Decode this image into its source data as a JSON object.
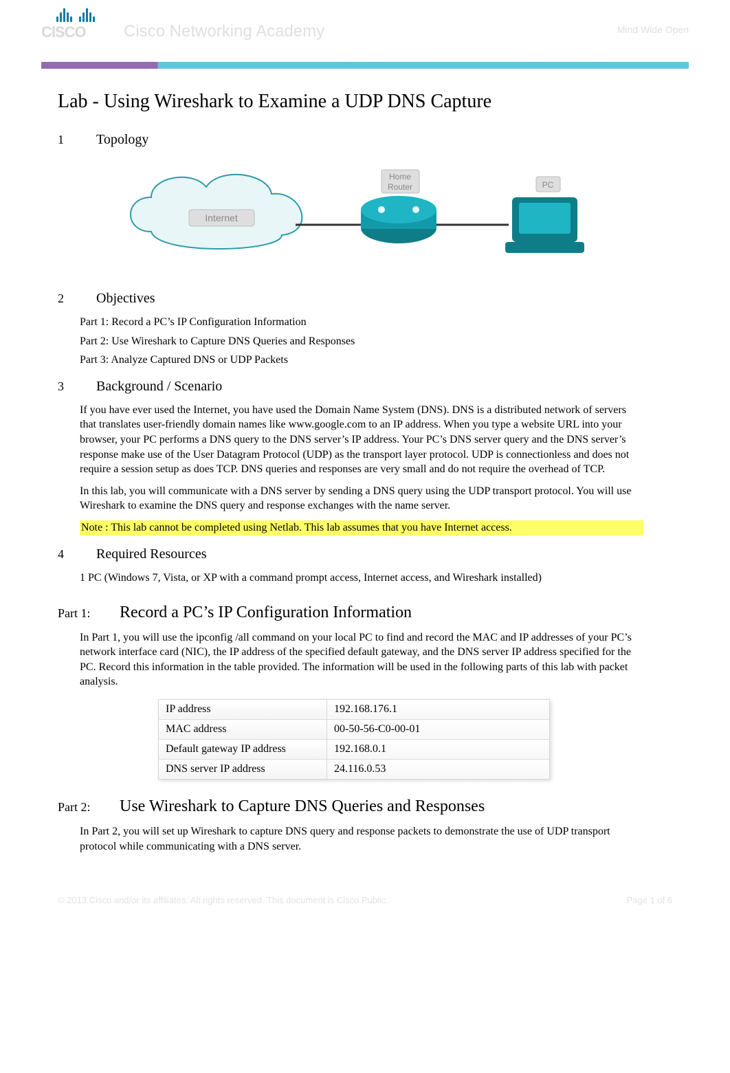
{
  "header": {
    "logo_text": "CISCO",
    "academy": "Cisco Networking Academy",
    "right_label": "Mind Wide Open"
  },
  "doc_title": "Lab - Using Wireshark to Examine a UDP DNS Capture",
  "sections": {
    "s1": {
      "num": "1",
      "title": "Topology"
    },
    "s2": {
      "num": "2",
      "title": "Objectives"
    },
    "s3": {
      "num": "3",
      "title": "Background / Scenario"
    },
    "s4": {
      "num": "4",
      "title": "Required Resources"
    }
  },
  "topology_labels": {
    "internet": "Internet",
    "router_line1": "Home",
    "router_line2": "Router",
    "pc": "PC"
  },
  "objectives": {
    "p1": "Part 1: Record a PC’s IP Configuration Information",
    "p2": "Part 2: Use Wireshark to Capture DNS Queries and Responses",
    "p3": "Part 3: Analyze Captured DNS or UDP Packets"
  },
  "background": {
    "para1": "If you have ever used the Internet, you have used the Domain Name System (DNS). DNS is a distributed network of servers that translates user-friendly domain names like www.google.com to an IP address. When you type a website URL into your browser, your PC performs a DNS query to the DNS server’s IP address. Your PC’s DNS server query and the DNS server’s response make use of the User Datagram Protocol (UDP) as the transport layer protocol. UDP is connectionless and does not require a session setup as does TCP. DNS queries and responses are very small and do not require the overhead of TCP.",
    "para2": "In this lab, you will communicate with a DNS server by sending a DNS query using the UDP transport protocol. You will use Wireshark to examine the DNS query and response exchanges with the name server.",
    "note": "Note : This lab cannot be completed using Netlab. This lab assumes that you have Internet access."
  },
  "resources": {
    "line1": "1 PC (Windows 7, Vista, or XP with a command prompt access, Internet access, and Wireshark installed)"
  },
  "part1": {
    "label": "Part 1:",
    "title": "Record a PC’s IP Configuration Information",
    "intro_a": "In Part 1, you will use the ",
    "intro_cmd": " ipconfig /all ",
    "intro_b": " command on your local PC to find and record the MAC and IP addresses of your PC’s network interface card (NIC), the IP address of the specified default gateway, and the DNS server IP address specified for the PC. Record this information in the table provided. The information will be used in the following parts of this lab with packet analysis.",
    "table": {
      "r1k": "IP address",
      "r1v": "192.168.176.1",
      "r2k": "MAC address",
      "r2v": "00-50-56-C0-00-01",
      "r3k": "Default gateway IP address",
      "r3v": "192.168.0.1",
      "r4k": "DNS server IP address",
      "r4v": "24.116.0.53"
    }
  },
  "part2": {
    "label": "Part 2:",
    "title": "Use Wireshark to Capture DNS Queries and Responses",
    "para": "In Part 2, you will set up Wireshark to capture DNS query and response packets to demonstrate the use of UDP transport protocol while communicating with a DNS server."
  },
  "footer": {
    "left": "© 2013 Cisco and/or its affiliates. All rights reserved. This document is Cisco Public.",
    "right": "Page 1 of 6"
  }
}
